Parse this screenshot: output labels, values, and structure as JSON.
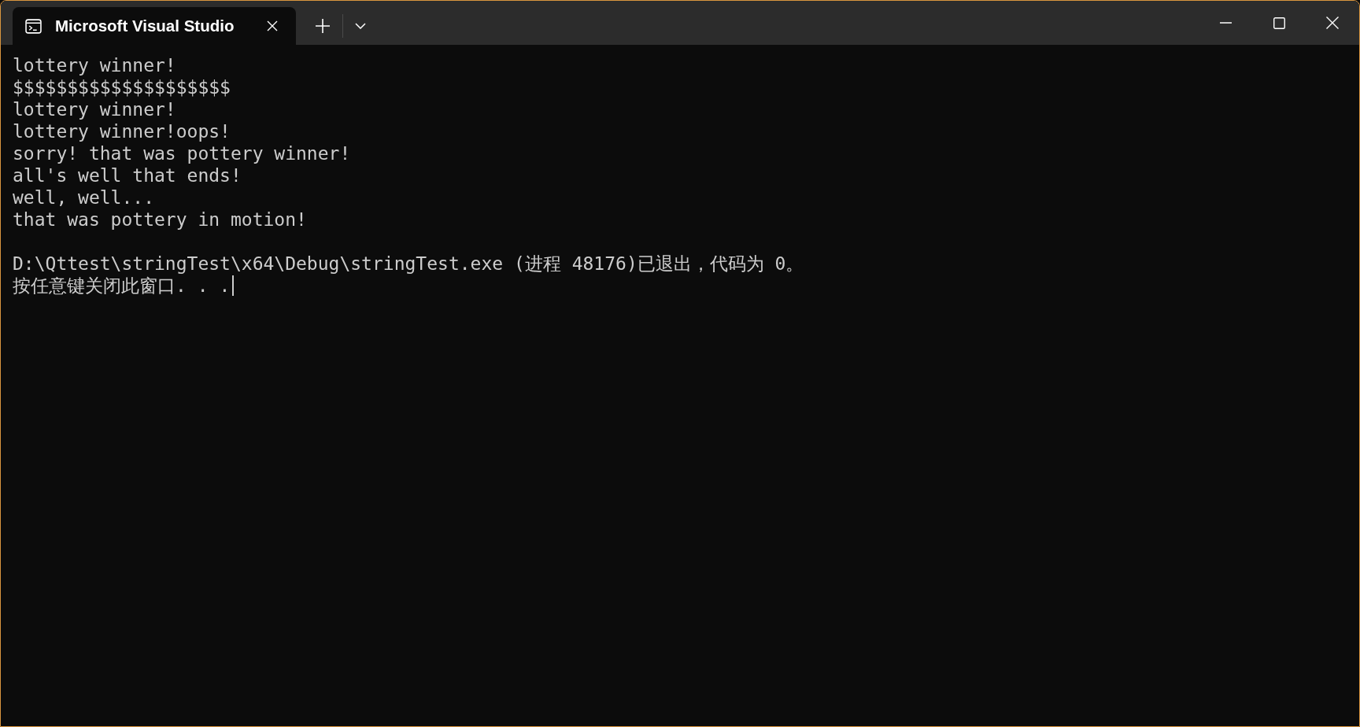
{
  "window": {
    "tabs": [
      {
        "title": "Microsoft Visual Studio",
        "selected": true
      }
    ]
  },
  "console": {
    "output_lines": [
      "lottery winner!",
      "$$$$$$$$$$$$$$$$$$$$",
      "lottery winner!",
      "lottery winner!oops!",
      "sorry! that was pottery winner!",
      "all's well that ends!",
      "well, well...",
      "that was pottery in motion!"
    ],
    "exit_lines": [
      "D:\\Qttest\\stringTest\\x64\\Debug\\stringTest.exe (进程 48176)已退出，代码为 0。",
      "按任意键关闭此窗口. . ."
    ],
    "cursor": true
  }
}
